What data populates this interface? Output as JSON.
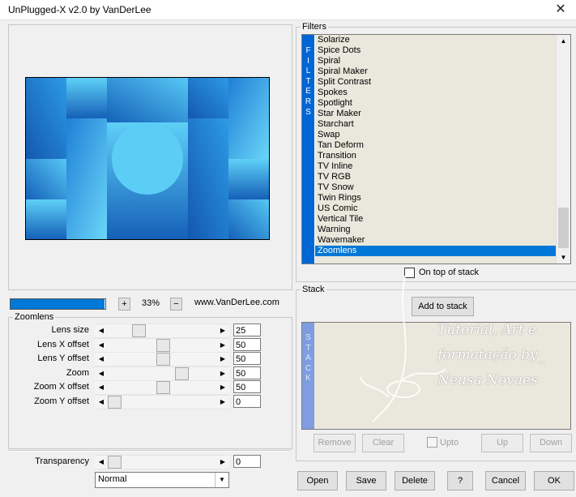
{
  "window": {
    "title": "UnPlugged-X v2.0 by VanDerLee",
    "close_glyph": "✕"
  },
  "preview": {
    "zoom_value": "33%",
    "zoom_plus": "+",
    "zoom_minus": "−",
    "website": "www.VanDerLee.com",
    "progress_fraction": 0.3
  },
  "zoomlens": {
    "legend": "Zoomlens",
    "params": [
      {
        "label": "Lens size",
        "value": "25",
        "fraction": 0.25
      },
      {
        "label": "Lens X offset",
        "value": "50",
        "fraction": 0.5
      },
      {
        "label": "Lens Y offset",
        "value": "50",
        "fraction": 0.5
      },
      {
        "label": "Zoom",
        "value": "50",
        "fraction": 0.7
      },
      {
        "label": "Zoom X offset",
        "value": "50",
        "fraction": 0.5
      },
      {
        "label": "Zoom Y offset",
        "value": "0",
        "fraction": 0.0
      }
    ]
  },
  "transparency": {
    "label": "Transparency",
    "value": "0",
    "fraction": 0.0
  },
  "blend_mode": {
    "selected": "Normal"
  },
  "filters": {
    "legend": "Filters",
    "side_label": [
      "F",
      "I",
      "L",
      "T",
      "E",
      "R",
      "S"
    ],
    "items": [
      "Solarize",
      "Spice Dots",
      "Spiral",
      "Spiral Maker",
      "Split Contrast",
      "Spokes",
      "Spotlight",
      "Star Maker",
      "Starchart",
      "Swap",
      "Tan Deform",
      "Transition",
      "TV Inline",
      "TV RGB",
      "TV Snow",
      "Twin Rings",
      "US Comic",
      "Vertical Tile",
      "Warning",
      "Wavemaker",
      "Zoomlens"
    ],
    "selected_index": 20,
    "on_top_label": "On top of stack"
  },
  "stack": {
    "legend": "Stack",
    "side_label": [
      "S",
      "T",
      "A",
      "C",
      "K"
    ],
    "add_label": "Add to stack",
    "remove_label": "Remove",
    "clear_label": "Clear",
    "upto_label": "Upto",
    "up_label": "Up",
    "down_label": "Down"
  },
  "watermark": {
    "line1": "Tutorial, Art e",
    "line2": "formatação by_",
    "line3": "Neusa Novaes"
  },
  "bottom": {
    "open": "Open",
    "save": "Save",
    "delete": "Delete",
    "help": "?",
    "cancel": "Cancel",
    "ok": "OK"
  },
  "colors": {
    "accent": "#0078d7",
    "filters_bar": "#0066d6",
    "stack_bar": "#7f9de0",
    "list_bg": "#eae7dc"
  }
}
